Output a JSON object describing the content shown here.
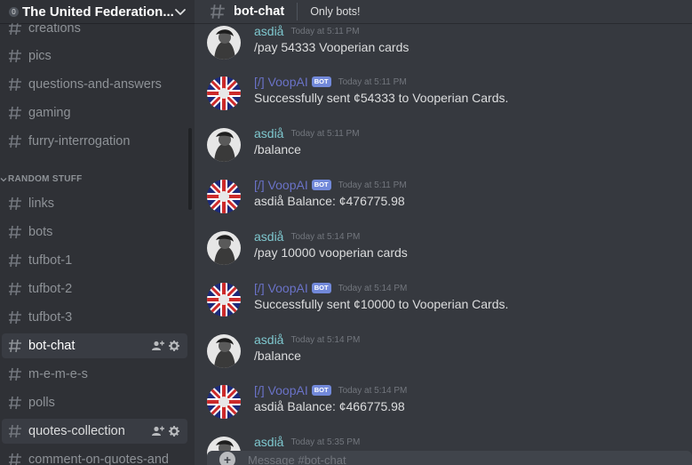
{
  "server": {
    "badge": "0",
    "name": "The United Federation..."
  },
  "sidebar": {
    "category": "RANDOM STUFF",
    "channels": [
      {
        "label": "creations"
      },
      {
        "label": "pics"
      },
      {
        "label": "questions-and-answers"
      },
      {
        "label": "gaming"
      },
      {
        "label": "furry-interrogation"
      },
      {
        "label": "links"
      },
      {
        "label": "bots"
      },
      {
        "label": "tufbot-1"
      },
      {
        "label": "tufbot-2"
      },
      {
        "label": "tufbot-3"
      },
      {
        "label": "bot-chat",
        "active": true
      },
      {
        "label": "m-e-m-e-s"
      },
      {
        "label": "polls"
      },
      {
        "label": "quotes-collection"
      },
      {
        "label": "comment-on-quotes-and"
      }
    ]
  },
  "header": {
    "channel": "bot-chat",
    "topic": "Only bots!"
  },
  "messages": [
    {
      "author": "asdiå",
      "bot": false,
      "time": "Today at 5:11 PM",
      "text": "/pay 54333 Vooperian cards"
    },
    {
      "author": "[/] VoopAI",
      "bot": true,
      "bot_tag": "BOT",
      "time": "Today at 5:11 PM",
      "text": "Successfully sent ¢54333 to Vooperian Cards."
    },
    {
      "author": "asdiå",
      "bot": false,
      "time": "Today at 5:11 PM",
      "text": "/balance"
    },
    {
      "author": "[/] VoopAI",
      "bot": true,
      "bot_tag": "BOT",
      "time": "Today at 5:11 PM",
      "text": "asdiå Balance: ¢476775.98"
    },
    {
      "author": "asdiå",
      "bot": false,
      "time": "Today at 5:14 PM",
      "text": "/pay 10000 vooperian cards"
    },
    {
      "author": "[/] VoopAI",
      "bot": true,
      "bot_tag": "BOT",
      "time": "Today at 5:14 PM",
      "text": "Successfully sent ¢10000 to Vooperian Cards."
    },
    {
      "author": "asdiå",
      "bot": false,
      "time": "Today at 5:14 PM",
      "text": "/balance"
    },
    {
      "author": "[/] VoopAI",
      "bot": true,
      "bot_tag": "BOT",
      "time": "Today at 5:14 PM",
      "text": "asdiå Balance: ¢466775.98"
    },
    {
      "author": "asdiå",
      "bot": false,
      "time": "Today at 5:35 PM",
      "text": ""
    }
  ],
  "composer": {
    "placeholder": "Message #bot-chat"
  },
  "colors": {
    "accent": "#7289da",
    "user_name": "#7ec7ce",
    "bot_name": "#6a72c7"
  },
  "icons": {
    "server_menu": "chevron-down-icon",
    "channel": "hash-icon",
    "channel_actions": [
      "add-member-icon",
      "gear-icon"
    ],
    "composer_add": "plus-circle-icon"
  }
}
